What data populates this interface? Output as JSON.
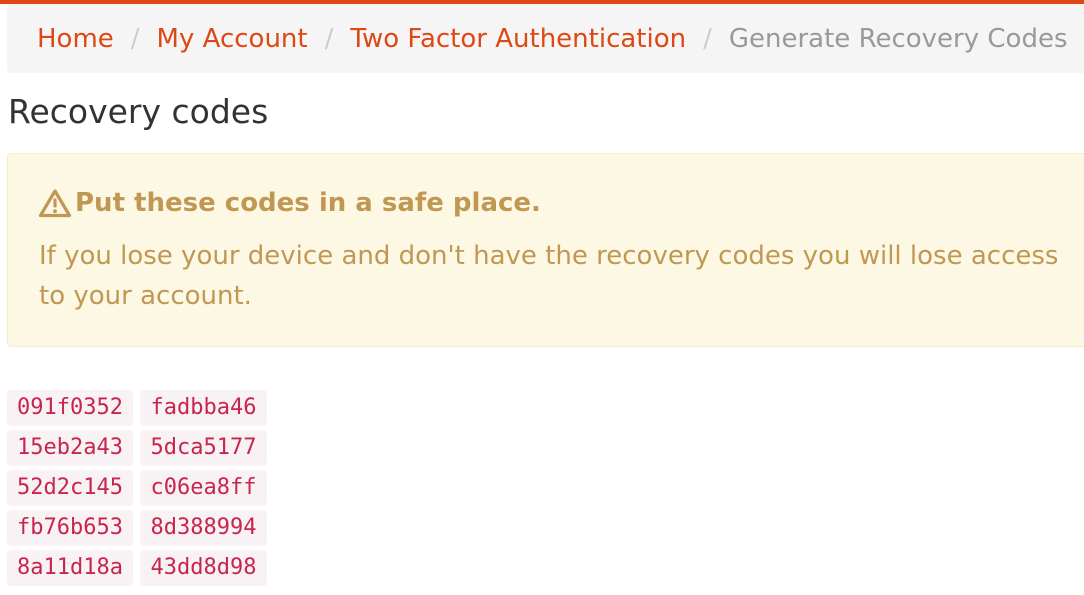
{
  "breadcrumb": {
    "items": [
      {
        "label": "Home"
      },
      {
        "label": "My Account"
      },
      {
        "label": "Two Factor Authentication"
      }
    ],
    "separator": "/",
    "active": "Generate Recovery Codes"
  },
  "page": {
    "title": "Recovery codes"
  },
  "alert": {
    "icon": "warning-icon",
    "heading": "Put these codes in a safe place.",
    "body": "If you lose your device and don't have the recovery codes you will lose access to your account."
  },
  "codes": [
    [
      "091f0352",
      "fadbba46"
    ],
    [
      "15eb2a43",
      "5dca5177"
    ],
    [
      "52d2c145",
      "c06ea8ff"
    ],
    [
      "fb76b653",
      "8d388994"
    ],
    [
      "8a11d18a",
      "43dd8d98"
    ]
  ],
  "colors": {
    "accent": "#dd4814",
    "warning_text": "#c09853",
    "warning_bg": "#fcf8e3",
    "code_text": "#c7254e",
    "code_bg": "#f9f2f4"
  }
}
